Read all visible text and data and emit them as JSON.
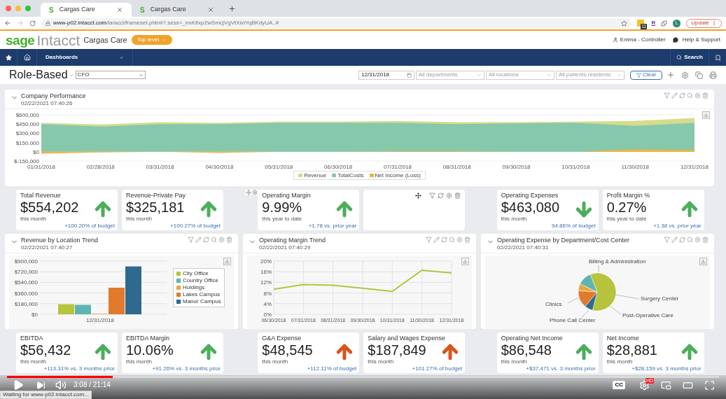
{
  "browser": {
    "tabs": [
      {
        "icon_letter": "S",
        "title": "Cargas Care",
        "selected": true
      },
      {
        "icon_letter": "S",
        "title": "Cargas Care",
        "selected": false
      }
    ],
    "url_host": "www-p02.intacct.com",
    "url_path": "/ia/acct/frameset.phtml?.sess=_ImKltxpZwSmcjVgVtXiviYqBKdyUA..#",
    "extension_badge": "11",
    "extension_letter": "R",
    "profile_initial": "L",
    "update_button": "Update"
  },
  "header": {
    "brand_sage": "sage",
    "brand_product": "Intacct",
    "company": "Cargas Care",
    "entity_button": "Top level",
    "user": "Emma - Controller",
    "help": "Help & Support"
  },
  "nav": {
    "menu": "Dashboards",
    "search": "Search"
  },
  "toolbar": {
    "title": "Role-Based",
    "role": "CFO",
    "date": "12/31/2018",
    "filters": [
      {
        "placeholder": "All departments"
      },
      {
        "placeholder": "All locations"
      },
      {
        "placeholder": "All patients-residents"
      }
    ],
    "clear": "Clear"
  },
  "company_performance": {
    "title": "Company Performance",
    "timestamp": "02/22/2021 07:40:26",
    "chart_data": {
      "type": "area",
      "x": [
        "01/31/2018",
        "02/28/2018",
        "03/31/2018",
        "04/30/2018",
        "05/31/2018",
        "06/30/2018",
        "07/31/2018",
        "08/31/2018",
        "09/30/2018",
        "10/31/2018",
        "11/30/2018",
        "12/31/2018"
      ],
      "series": [
        {
          "name": "Revenue",
          "color": "#d6dc8c",
          "values": [
            470000,
            440000,
            480000,
            470000,
            490000,
            490000,
            500000,
            480000,
            480000,
            490000,
            500000,
            550000
          ]
        },
        {
          "name": "TotalCosts",
          "color": "#86c8ac",
          "values": [
            450000,
            410000,
            450000,
            450000,
            470000,
            470000,
            470000,
            450000,
            460000,
            470000,
            420000,
            470000
          ]
        },
        {
          "name": "Net Income (Loss)",
          "color": "#f0b440",
          "values": [
            -30000,
            -10000,
            0,
            -20000,
            0,
            0,
            10000,
            10000,
            0,
            0,
            40000,
            30000
          ]
        }
      ],
      "ylim": [
        -150000,
        600000
      ],
      "yticks": [
        {
          "value": 600000,
          "label": "$600,000"
        },
        {
          "value": 450000,
          "label": "$450,000"
        },
        {
          "value": 300000,
          "label": "$300,000"
        },
        {
          "value": 150000,
          "label": "$150,000"
        },
        {
          "value": 0,
          "label": "$0"
        },
        {
          "value": -150000,
          "label": "$-150,000"
        }
      ],
      "stacked": false
    }
  },
  "kpis_top": [
    {
      "kind": "metric",
      "title": "Total Revenue",
      "value": "$554,202",
      "period": "this month",
      "footnote": "+100.20% of budget",
      "up": true,
      "favorable": true
    },
    {
      "kind": "metric",
      "title": "Revenue-Private Pay",
      "value": "$325,181",
      "period": "this month",
      "footnote": "+100.27% of budget",
      "up": true,
      "favorable": true
    },
    {
      "kind": "metric",
      "title": "Operating Margin",
      "value": "9.99%",
      "period": "this year to date",
      "footnote": "+1.78 vs. prior year",
      "up": true,
      "favorable": true
    },
    {
      "kind": "empty"
    },
    {
      "kind": "metric",
      "title": "Operating Expenses",
      "value": "$463,080",
      "period": "this month",
      "footnote": "94.86% of budget",
      "up": false,
      "favorable": true
    },
    {
      "kind": "metric",
      "title": "Profit Margin %",
      "value": "0.27%",
      "period": "this year to date",
      "footnote": "+1.38 vs. prior year",
      "up": true,
      "favorable": true
    }
  ],
  "panels": [
    {
      "kind": "chart",
      "title": "Revenue by Location Trend",
      "timestamp": "02/22/2021 07:40:27",
      "chart_data": {
        "type": "bar",
        "grid": true,
        "categories": [
          "12/31/2018"
        ],
        "series": [
          {
            "name": "City Office",
            "color": "#b5c43c",
            "values": [
              170000
            ]
          },
          {
            "name": "Country Office",
            "color": "#5fb3b3",
            "values": [
              160000
            ]
          },
          {
            "name": "Holdings",
            "color": "#e8a838",
            "values": [
              10000
            ]
          },
          {
            "name": "Lakes Campus",
            "color": "#e27a2e",
            "values": [
              450000
            ]
          },
          {
            "name": "Manor Campus",
            "color": "#2e6a8e",
            "values": [
              810000
            ]
          }
        ],
        "ylim": [
          0,
          900000
        ],
        "yticks": [
          {
            "value": 900000,
            "label": "$900,000"
          },
          {
            "value": 720000,
            "label": "$720,000"
          },
          {
            "value": 540000,
            "label": "$540,000"
          },
          {
            "value": 360000,
            "label": "$360,000"
          },
          {
            "value": 180000,
            "label": "$180,000"
          },
          {
            "value": 0,
            "label": "$0"
          }
        ]
      }
    },
    {
      "kind": "chart",
      "title": "Operating Margin Trend",
      "timestamp": "02/22/2021 07:40:29",
      "chart_data": {
        "type": "line",
        "grid": true,
        "x": [
          "06/30/2018",
          "07/31/2018",
          "08/31/2018",
          "09/30/2018",
          "10/31/2018",
          "11/30/2018",
          "12/31/2018"
        ],
        "series": [
          {
            "color": "#b5c43c",
            "values": [
              9.4,
              11.2,
              10.9,
              9.8,
              8.6,
              16.6,
              15.5
            ]
          }
        ],
        "ylim": [
          0,
          20
        ],
        "yticks": [
          {
            "value": 20,
            "label": "20%"
          },
          {
            "value": 16,
            "label": "16%"
          },
          {
            "value": 12,
            "label": "12%"
          },
          {
            "value": 8,
            "label": "8%"
          },
          {
            "value": 4,
            "label": "4%"
          },
          {
            "value": 0,
            "label": "0%"
          }
        ]
      }
    },
    {
      "kind": "pie",
      "title": "Operating Expense by Department/Cost Center",
      "timestamp": "02/22/2021 07:40:31",
      "pie_labels": [
        "Billing & Administration",
        "Clinics",
        "Surgery Center",
        "Phone Call Center",
        "Post-Operative Care"
      ]
    }
  ],
  "kpis_bottom": [
    {
      "kind": "metric",
      "title": "EBITDA",
      "value": "$56,432",
      "period": "this month",
      "footnote": "+113.31% vs. 3 months prior",
      "up": true,
      "favorable": true
    },
    {
      "kind": "metric",
      "title": "EBITDA Margin",
      "value": "10.06%",
      "period": "this month",
      "footnote": "+91.26% vs. 3 months prior",
      "up": true,
      "favorable": true
    },
    {
      "kind": "metric",
      "title": "G&A Expense",
      "value": "$48,545",
      "period": "this month",
      "footnote": "+112.11% of budget",
      "up": true,
      "favorable": false
    },
    {
      "kind": "metric",
      "title": "Salary and Wages Expense",
      "value": "$187,849",
      "period": "this month",
      "footnote": "+101.27% of budget",
      "up": true,
      "favorable": false
    },
    {
      "kind": "metric",
      "title": "Operating Net Income",
      "value": "$86,548",
      "period": "this month",
      "footnote": "+$37,471 vs. 3 months prior",
      "up": true,
      "favorable": true
    },
    {
      "kind": "metric",
      "title": "Net Income",
      "value": "$28,881",
      "period": "this month",
      "footnote": "+$28,159 vs. 3 months prior",
      "up": true,
      "favorable": true
    }
  ],
  "video": {
    "time": "3:08 / 21:14",
    "level": 0.148,
    "captions": "CC",
    "quality_badge": "HD"
  },
  "status": "Waiting for www-p02.intacct.com..."
}
